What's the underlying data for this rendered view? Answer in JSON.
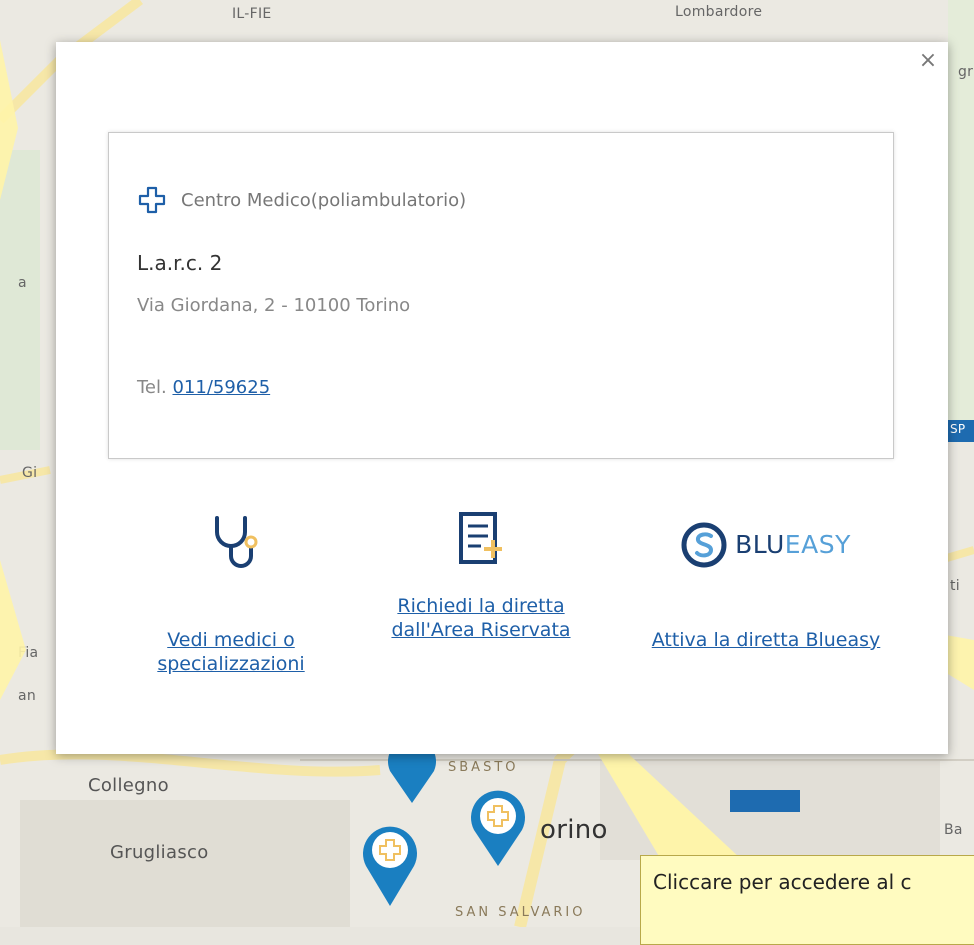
{
  "map": {
    "labels": {
      "top_left": "IL-FIE",
      "top_center": "Lombardore",
      "left_a": "a",
      "left_gi": "Gi",
      "left_fia": "Fia",
      "left_an": "an",
      "collegno": "Collegno",
      "grugliasco": "Grugliasco",
      "torino": "orino",
      "san_salvario": "SAN SALVARIO",
      "right_gr": "gr",
      "right_ba": "Ba",
      "right_ti": "ti",
      "badge": "SP",
      "sbaro": "SBASTO"
    }
  },
  "popup": {
    "close_symbol": "×",
    "category_label": "Centro Medico(poliambulatorio)",
    "name": "L.a.r.c. 2",
    "address": "Via Giordana, 2 - 10100 Torino",
    "tel_label": "Tel. ",
    "tel_number": "011/59625",
    "actions": {
      "doctors_label": "Vedi medici o specializzazioni",
      "request_label": "Richiedi la diretta dall'Area Riservata",
      "blueasy_label": "Attiva la diretta Blueasy",
      "blueasy_brand_dark": "BLU",
      "blueasy_brand_light": "EASY"
    }
  },
  "callout": {
    "text": "Cliccare per accedere al c"
  },
  "colors": {
    "link": "#1e5fa8",
    "brand_dark": "#1a3f72",
    "brand_light": "#56a0d8",
    "tooltip_bg": "#fffbc0",
    "pin": "#1a7fc1"
  }
}
